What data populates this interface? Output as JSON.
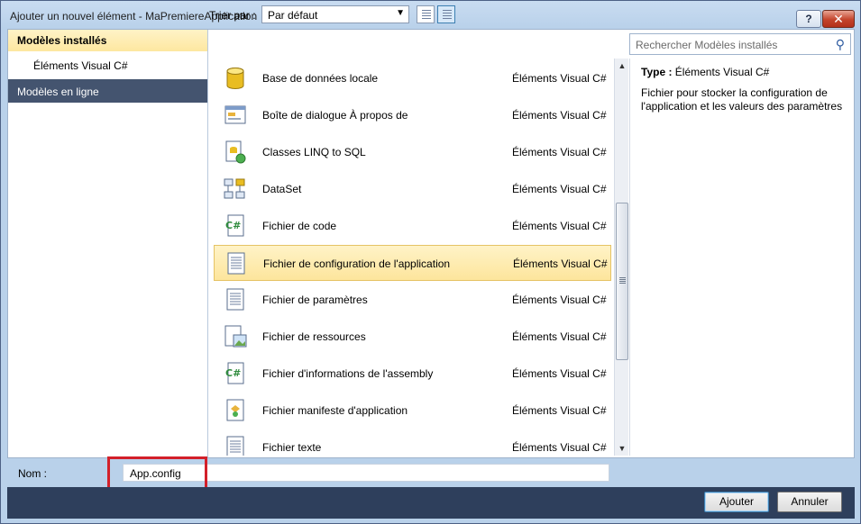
{
  "window": {
    "title": "Ajouter un nouvel élément - MaPremiereApplication",
    "help_label": "?",
    "close_label": "✕"
  },
  "left": {
    "installed": "Modèles installés",
    "csharp": "Éléments Visual C#",
    "online": "Modèles en ligne"
  },
  "toolbar": {
    "sort_label": "Trier par :",
    "sort_value": "Par défaut"
  },
  "search": {
    "placeholder": "Rechercher Modèles installés"
  },
  "items": [
    {
      "name": "Base de données locale",
      "category": "Éléments Visual C#",
      "icon": "database-icon"
    },
    {
      "name": "Boîte de dialogue À propos de",
      "category": "Éléments Visual C#",
      "icon": "dialog-icon"
    },
    {
      "name": "Classes LINQ to SQL",
      "category": "Éléments Visual C#",
      "icon": "linq-icon"
    },
    {
      "name": "DataSet",
      "category": "Éléments Visual C#",
      "icon": "dataset-icon"
    },
    {
      "name": "Fichier de code",
      "category": "Éléments Visual C#",
      "icon": "csharp-file-icon"
    },
    {
      "name": "Fichier de configuration de l'application",
      "category": "Éléments Visual C#",
      "icon": "config-file-icon",
      "selected": true
    },
    {
      "name": "Fichier de paramètres",
      "category": "Éléments Visual C#",
      "icon": "settings-file-icon"
    },
    {
      "name": "Fichier de ressources",
      "category": "Éléments Visual C#",
      "icon": "resource-file-icon"
    },
    {
      "name": "Fichier d'informations de l'assembly",
      "category": "Éléments Visual C#",
      "icon": "csharp-file-icon"
    },
    {
      "name": "Fichier manifeste d'application",
      "category": "Éléments Visual C#",
      "icon": "manifest-icon"
    },
    {
      "name": "Fichier texte",
      "category": "Éléments Visual C#",
      "icon": "text-file-icon"
    }
  ],
  "detail": {
    "type_label": "Type :",
    "type_value": "Éléments Visual C#",
    "description": "Fichier pour stocker la configuration de l'application et les valeurs des paramètres"
  },
  "name_field": {
    "label": "Nom :",
    "value": "App.config"
  },
  "buttons": {
    "add_label": "Ajouter",
    "cancel_label": "Annuler"
  },
  "colors": {
    "selection": "#fde59c",
    "online_bg": "#44546f",
    "highlight": "#d3202a"
  }
}
